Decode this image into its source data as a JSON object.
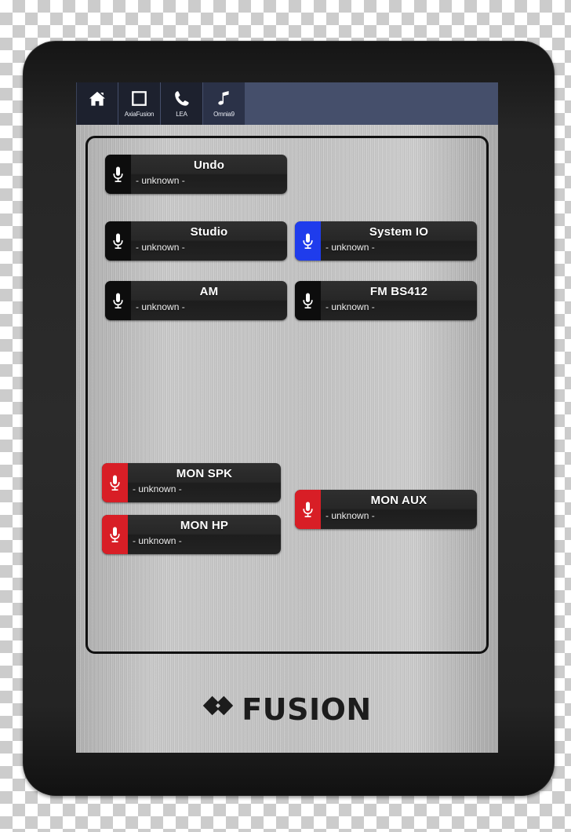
{
  "toolbar": {
    "tabs": [
      {
        "id": "home",
        "label": "",
        "icon": "home-icon",
        "selected": false
      },
      {
        "id": "axiafusion",
        "label": "AxiaFusion",
        "icon": "square-icon",
        "selected": false
      },
      {
        "id": "lea",
        "label": "LEA",
        "icon": "phone-icon",
        "selected": false
      },
      {
        "id": "omnia9",
        "label": "Omnia9",
        "icon": "music-note-icon",
        "selected": true
      }
    ],
    "background_color": "#454f6b",
    "tab_color": "#1d212e",
    "tab_selected_color": "#2b3248"
  },
  "sources": [
    {
      "id": "undo",
      "title": "Undo",
      "status": "- unknown -",
      "state_color": "#0d0d0d",
      "state": "off"
    },
    {
      "id": "studio",
      "title": "Studio",
      "status": "- unknown -",
      "state_color": "#0d0d0d",
      "state": "off"
    },
    {
      "id": "system-io",
      "title": "System IO",
      "status": "- unknown -",
      "state_color": "#1f3cec",
      "state": "blue"
    },
    {
      "id": "am",
      "title": "AM",
      "status": "- unknown -",
      "state_color": "#0d0d0d",
      "state": "off"
    },
    {
      "id": "fm-bs412",
      "title": "FM BS412",
      "status": "- unknown -",
      "state_color": "#0d0d0d",
      "state": "off"
    },
    {
      "id": "mon-spk",
      "title": "MON SPK",
      "status": "- unknown -",
      "state_color": "#d81e26",
      "state": "red"
    },
    {
      "id": "mon-aux",
      "title": "MON AUX",
      "status": "- unknown -",
      "state_color": "#d81e26",
      "state": "red"
    },
    {
      "id": "mon-hp",
      "title": "MON HP",
      "status": "- unknown -",
      "state_color": "#d81e26",
      "state": "red"
    }
  ],
  "brand": {
    "name": "FUSION",
    "mark": "double-diamond-icon"
  },
  "theme": {
    "panel_metal": "#c2c2c2",
    "bezel": "#262626",
    "button_body": "#272727"
  }
}
